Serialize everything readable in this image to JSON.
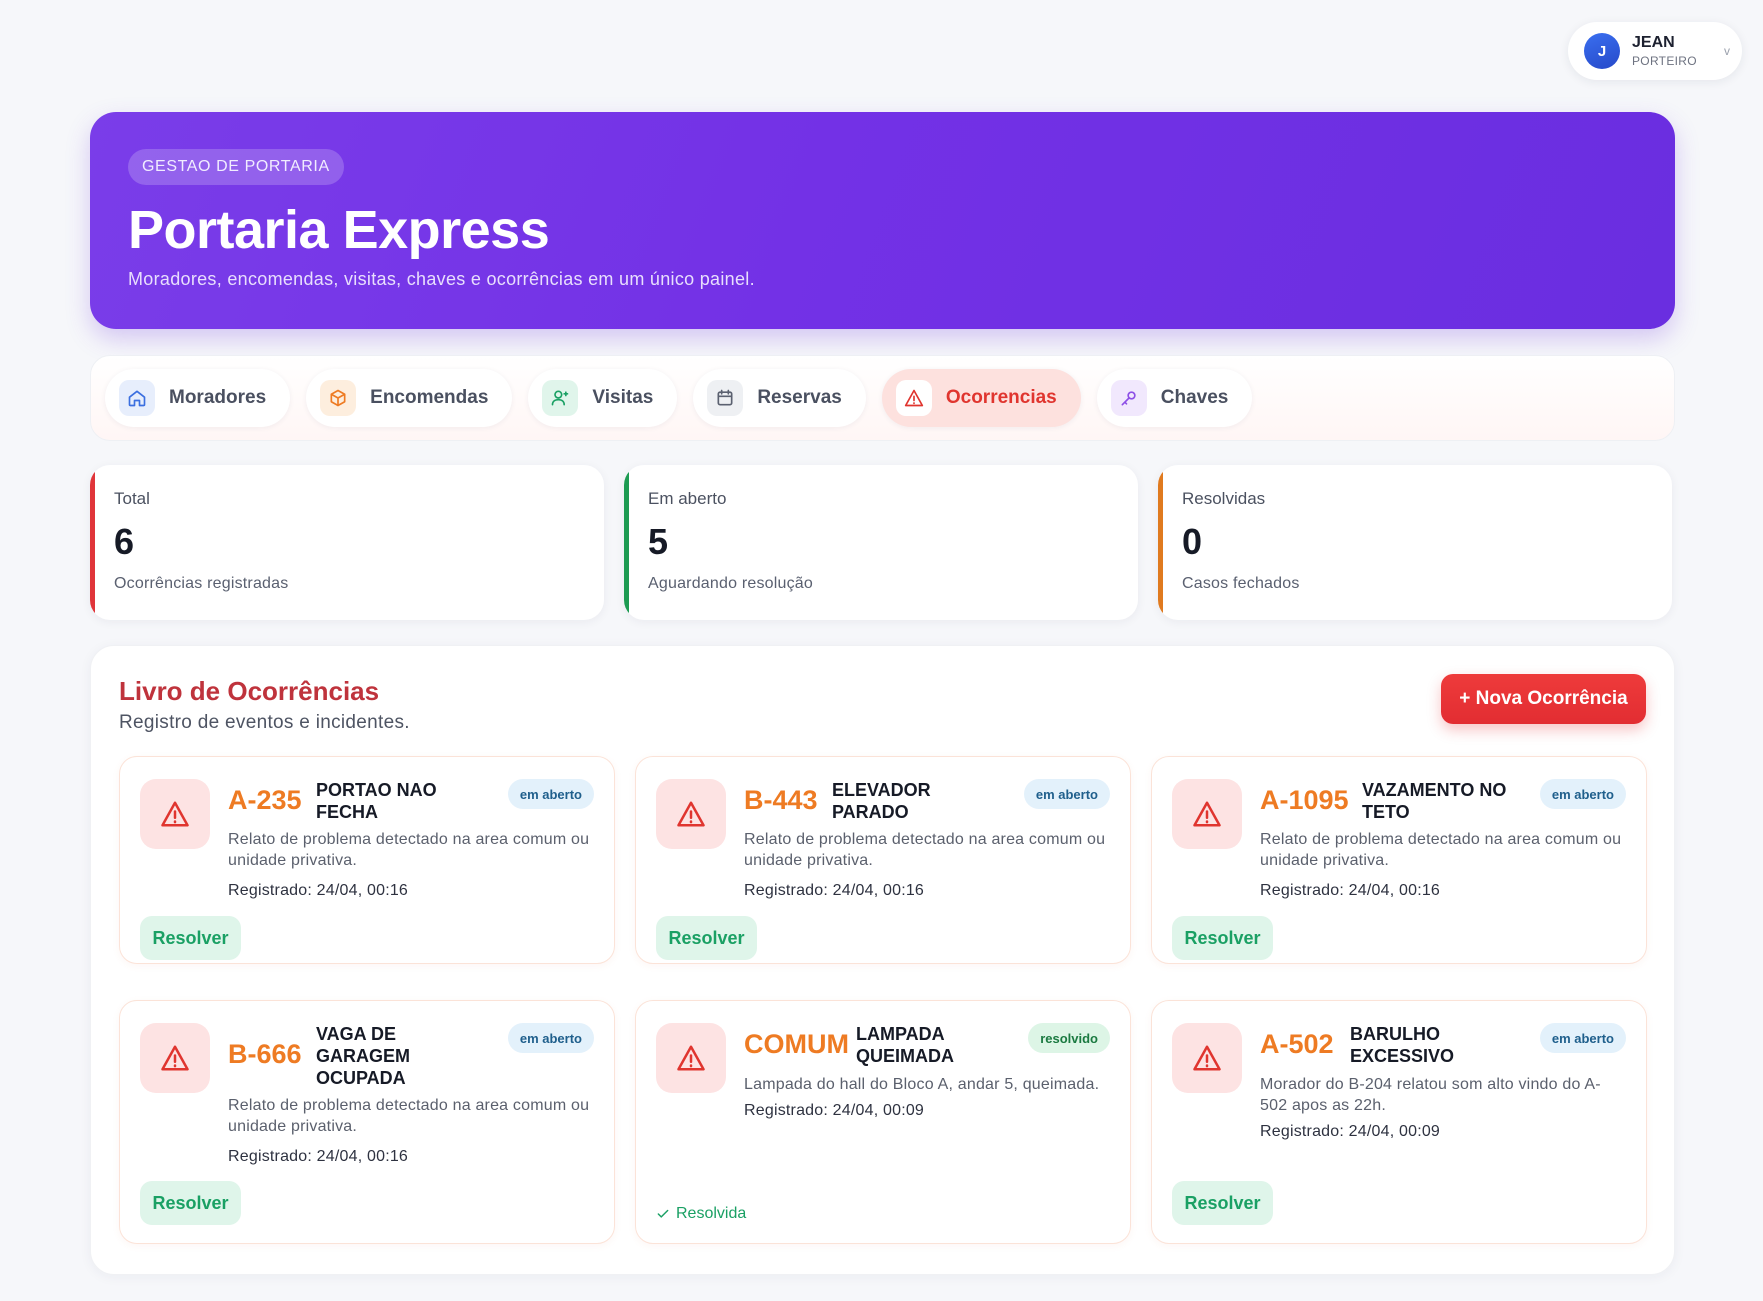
{
  "user": {
    "initial": "J",
    "name": "JEAN",
    "role": "PORTEIRO",
    "chevron": "v"
  },
  "hero": {
    "badge": "GESTAO DE PORTARIA",
    "title": "Portaria Express",
    "subtitle": "Moradores, encomendas, visitas, chaves e ocorrências em um único painel."
  },
  "tabs": [
    {
      "label": "Moradores",
      "icon": "home-icon",
      "color": "#3b6fe0"
    },
    {
      "label": "Encomendas",
      "icon": "package-icon",
      "color": "#ee7b23"
    },
    {
      "label": "Visitas",
      "icon": "user-add-icon",
      "color": "#1aa064"
    },
    {
      "label": "Reservas",
      "icon": "calendar-icon",
      "color": "#5b6170"
    },
    {
      "label": "Ocorrencias",
      "icon": "warning-icon",
      "color": "#e0352f",
      "active": true
    },
    {
      "label": "Chaves",
      "icon": "key-icon",
      "color": "#8d4fe6"
    }
  ],
  "stats": [
    {
      "label": "Total",
      "value": "6",
      "desc": "Ocorrências registradas",
      "accent": "#e0353a"
    },
    {
      "label": "Em aberto",
      "value": "5",
      "desc": "Aguardando resolução",
      "accent": "#1d9b52"
    },
    {
      "label": "Resolvidas",
      "value": "0",
      "desc": "Casos fechados",
      "accent": "#e07a1f"
    }
  ],
  "ledger": {
    "title": "Livro de Ocorrências",
    "subtitle": "Registro de eventos e incidentes.",
    "new_button": "+ Nova Ocorrência",
    "resolve_label": "Resolver",
    "resolved_label": "Resolvida",
    "items": [
      {
        "unit": "A-235",
        "title": "PORTAO NAO FECHA",
        "status": "em aberto",
        "desc": "Relato de problema detectado na area comum ou unidade privativa.",
        "date": "Registrado: 24/04, 00:16"
      },
      {
        "unit": "B-443",
        "title": "ELEVADOR PARADO",
        "status": "em aberto",
        "desc": "Relato de problema detectado na area comum ou unidade privativa.",
        "date": "Registrado: 24/04, 00:16"
      },
      {
        "unit": "A-1095",
        "title": "VAZAMENTO NO TETO",
        "status": "em aberto",
        "desc": "Relato de problema detectado na area comum ou unidade privativa.",
        "date": "Registrado: 24/04, 00:16"
      },
      {
        "unit": "B-666",
        "title": "VAGA DE GARAGEM OCUPADA",
        "status": "em aberto",
        "desc": "Relato de problema detectado na area comum ou unidade privativa.",
        "date": "Registrado: 24/04, 00:16"
      },
      {
        "unit": "COMUM",
        "title": "LAMPADA QUEIMADA",
        "status": "resolvido",
        "desc": "Lampada do hall do Bloco A, andar 5, queimada.",
        "date": "Registrado: 24/04, 00:09"
      },
      {
        "unit": "A-502",
        "title": "BARULHO EXCESSIVO",
        "status": "em aberto",
        "desc": "Morador do B-204 relatou som alto vindo do A-502 apos as 22h.",
        "date": "Registrado: 24/04, 00:09"
      }
    ]
  }
}
